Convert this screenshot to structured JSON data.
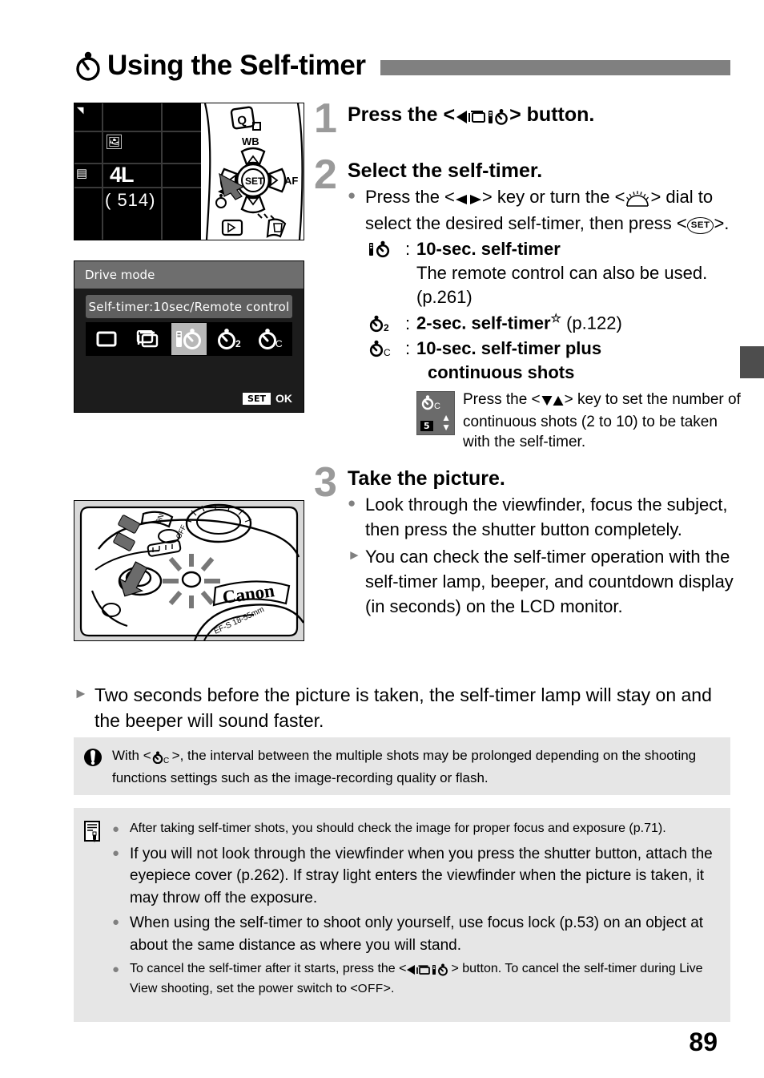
{
  "page": {
    "number": "89",
    "title": "Using the Self-timer",
    "title_icon": "self-timer-icon"
  },
  "figures": {
    "lcd_settings": {
      "name": "shooting-settings-screen",
      "quality": "4L",
      "shots_remaining": "( 514)",
      "pad_labels": {
        "wb": "WB",
        "af": "AF",
        "set": "SET",
        "q": "Q"
      }
    },
    "drive_menu": {
      "name": "drive-mode-screen",
      "header": "Drive mode",
      "selected_label": "Self-timer:10sec/Remote control",
      "items": [
        {
          "icon": "single-shooting-icon",
          "glyph": "▭",
          "selected": false
        },
        {
          "icon": "continuous-shooting-icon",
          "glyph": "⧉",
          "selected": false
        },
        {
          "icon": "self-timer-10sec-remote-icon",
          "glyph": "⏱",
          "selected": true
        },
        {
          "icon": "self-timer-2sec-icon",
          "glyph": "⏱₂",
          "selected": false
        },
        {
          "icon": "self-timer-continuous-icon",
          "glyph": "⏱C",
          "selected": false
        }
      ],
      "set_chip": "SET",
      "ok_label": "OK"
    },
    "camera": {
      "name": "camera-shutter-button-photo",
      "brand": "Canon",
      "lens": "EF-S 18-55mm"
    }
  },
  "steps": [
    {
      "number": "1",
      "heading_prefix": "Press the <",
      "heading_icon": "drive-mode-self-timer-button-icon",
      "heading_suffix": "> button.",
      "heading_plain": "Press the <◀ Drive/Self-timer> button."
    },
    {
      "number": "2",
      "heading": "Select the self-timer.",
      "bullets": [
        {
          "marker": "dot",
          "text_parts": [
            "Press the <",
            "◀▶",
            "> key or turn the <",
            "main-dial",
            "> dial to select the desired self-timer, then press <",
            "SET",
            ">."
          ]
        }
      ],
      "options": [
        {
          "icon": "self-timer-10sec-remote-icon",
          "label": "10-sec. self-timer",
          "sub": "The remote control can also be used. (p.261)"
        },
        {
          "icon": "self-timer-2sec-icon",
          "label": "2-sec. self-timer",
          "star": "☆",
          "page_ref": "(p.122)"
        },
        {
          "icon": "self-timer-continuous-icon",
          "label": "10-sec. self-timer plus",
          "label2": "continuous shots"
        }
      ],
      "subnote": {
        "fig_icon": "self-timer-continuous-count-icon",
        "fig_count": "5",
        "text_prefix": "Press the <",
        "text_keys": "▲▼",
        "text_suffix": "> key to set the number of continuous shots (2 to 10) to be taken with the self-timer."
      }
    },
    {
      "number": "3",
      "heading": "Take the picture.",
      "bullets": [
        {
          "marker": "dot",
          "text": "Look through the viewfinder, focus the subject, then press the shutter button completely."
        },
        {
          "marker": "triangle",
          "text": "You can check the self-timer operation with the self-timer lamp, beeper, and countdown display (in seconds) on the LCD monitor."
        }
      ]
    }
  ],
  "wide_note": {
    "marker": "triangle",
    "text": "Two seconds before the picture is taken, the self-timer lamp will stay on and the beeper will sound faster."
  },
  "caution": {
    "icon": "caution-icon",
    "prefix": "With <",
    "icon_inline": "self-timer-continuous-icon",
    "suffix": ">, the interval between the multiple shots may be prolonged depending on the shooting functions settings such as the image-recording quality or flash."
  },
  "notes": {
    "icon": "note-pencil-icon",
    "items": [
      {
        "size": "small",
        "text": "After taking self-timer shots, you should check the image for proper focus and exposure (p.71)."
      },
      {
        "size": "big",
        "text": "If you will not look through the viewfinder when you press the shutter button, attach the eyepiece cover (p.262). If stray light enters the viewfinder when the picture is taken, it may throw off the exposure."
      },
      {
        "size": "big",
        "text": "When using the self-timer to shoot only yourself, use focus lock (p.53) on an object at about the same distance as where you will stand."
      },
      {
        "size": "small",
        "prefix": "To cancel the self-timer after it starts, press the <",
        "icon_inline": "drive-mode-self-timer-button-icon",
        "mid": "> button. To cancel the self-timer during Live View shooting, set the power switch to <",
        "off_label": "OFF",
        "suffix": ">."
      }
    ]
  },
  "colors": {
    "header_bar": "#808080",
    "step_number": "#9a9a9a",
    "box_bg": "#e6e6e6",
    "edge_tab": "#4d4d4d"
  }
}
